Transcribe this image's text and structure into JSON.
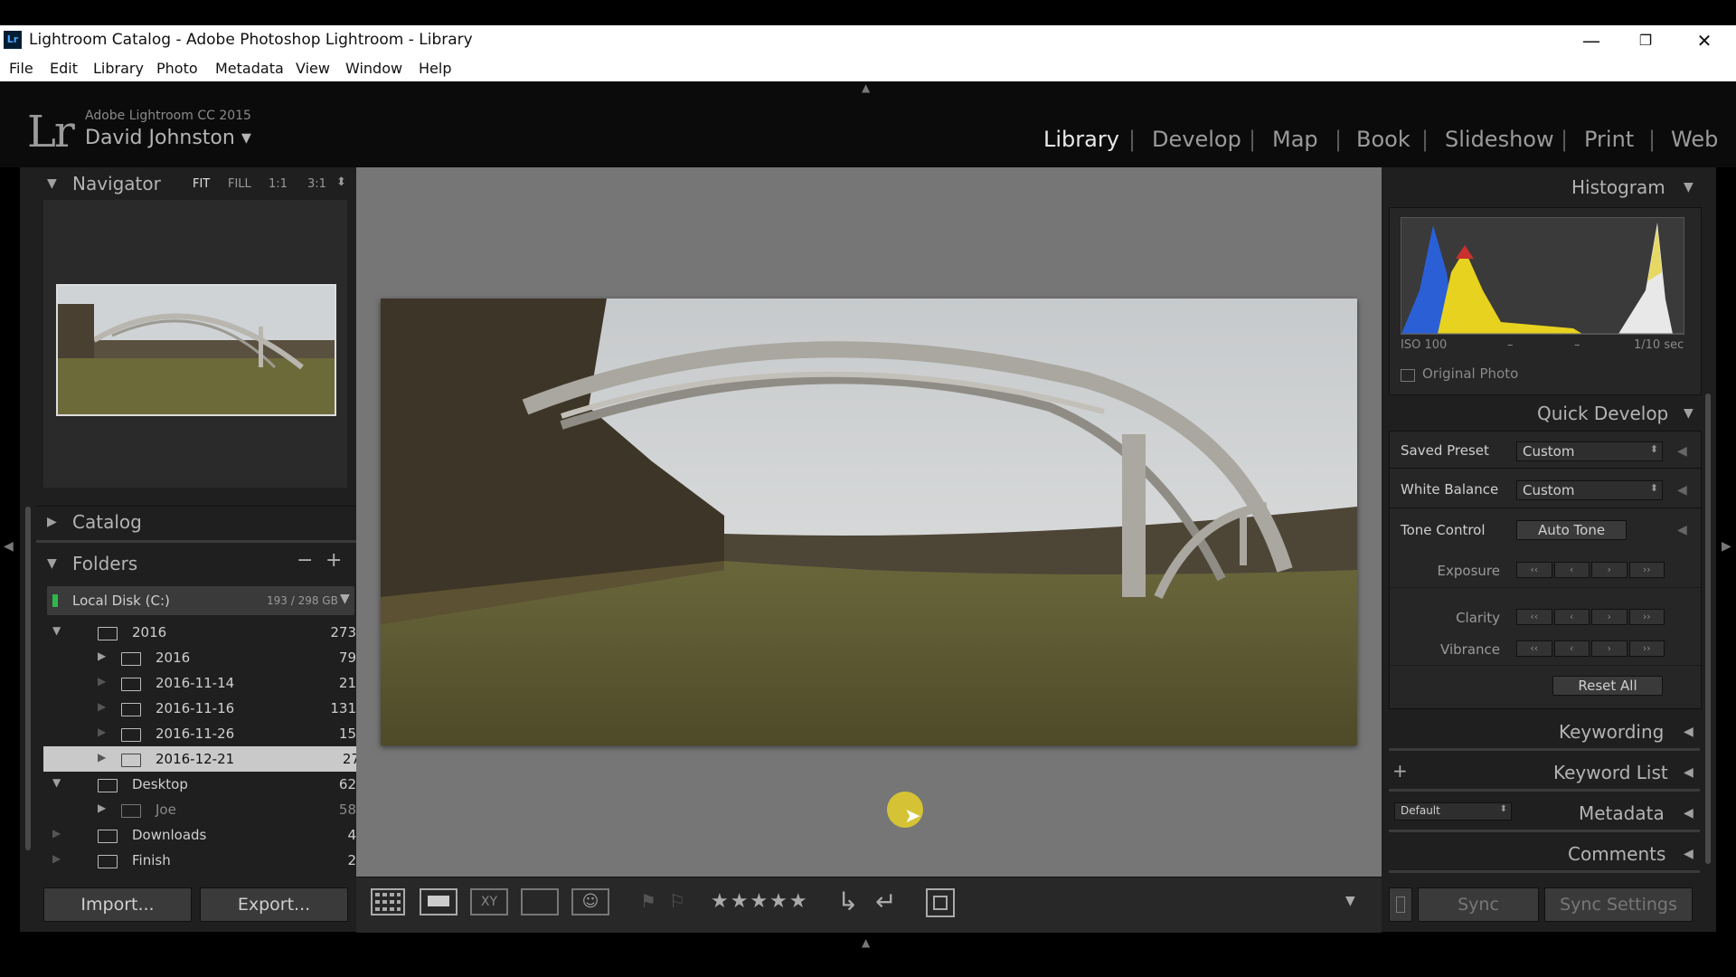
{
  "window": {
    "title": "Lightroom Catalog - Adobe Photoshop Lightroom - Library",
    "logo": "Lr",
    "controls": [
      "—",
      "❐",
      "✕"
    ]
  },
  "menu": [
    "File",
    "Edit",
    "Library",
    "Photo",
    "Metadata",
    "View",
    "Window",
    "Help"
  ],
  "identity": {
    "logo": "Lr",
    "product": "Adobe Lightroom CC 2015",
    "user": "David Johnston ▾"
  },
  "modules": [
    "Library",
    "Develop",
    "Map",
    "Book",
    "Slideshow",
    "Print",
    "Web"
  ],
  "active_module": "Library",
  "navigator": {
    "title": "Navigator",
    "zoom": [
      "FIT",
      "FILL",
      "1:1",
      "3:1"
    ]
  },
  "catalog": {
    "title": "Catalog"
  },
  "folders": {
    "title": "Folders",
    "minus": "−",
    "plus": "+",
    "volume": {
      "name": "Local Disk (C:)",
      "usage": "193 / 298 GB"
    },
    "rows": [
      {
        "name": "2016",
        "count": "273"
      },
      {
        "name": "2016",
        "count": "79"
      },
      {
        "name": "2016-11-14",
        "count": "21"
      },
      {
        "name": "2016-11-16",
        "count": "131"
      },
      {
        "name": "2016-11-26",
        "count": "15"
      },
      {
        "name": "2016-12-21",
        "count": "27"
      },
      {
        "name": "Desktop",
        "count": "62"
      },
      {
        "name": "Joe",
        "count": "58"
      },
      {
        "name": "Downloads",
        "count": "4"
      },
      {
        "name": "Finish",
        "count": "2"
      }
    ]
  },
  "left_buttons": {
    "import": "Import...",
    "export": "Export..."
  },
  "histogram": {
    "title": "Histogram",
    "iso": "ISO 100",
    "dash1": "–",
    "dash2": "–",
    "shutter": "1/10 sec",
    "original_photo": "Original Photo"
  },
  "quick_develop": {
    "title": "Quick Develop",
    "saved_preset_label": "Saved Preset",
    "saved_preset_value": "Custom",
    "white_balance_label": "White Balance",
    "white_balance_value": "Custom",
    "tone_control_label": "Tone Control",
    "auto_tone": "Auto Tone",
    "exposure": "Exposure",
    "clarity": "Clarity",
    "vibrance": "Vibrance",
    "reset_all": "Reset All"
  },
  "right_sections": {
    "keywording": "Keywording",
    "keyword_list": "Keyword List",
    "keyword_plus": "+",
    "metadata": "Metadata",
    "metadata_preset": "Default",
    "comments": "Comments"
  },
  "sync": {
    "sync": "Sync",
    "sync_settings": "Sync Settings"
  },
  "toolbar": {
    "stars": "★★★★★"
  },
  "colors": {
    "panel_bg": "#1f1f1f",
    "center_bg": "#767676",
    "selected_row": "#cfcfcf",
    "cursor_highlight": "#e6d12a"
  }
}
